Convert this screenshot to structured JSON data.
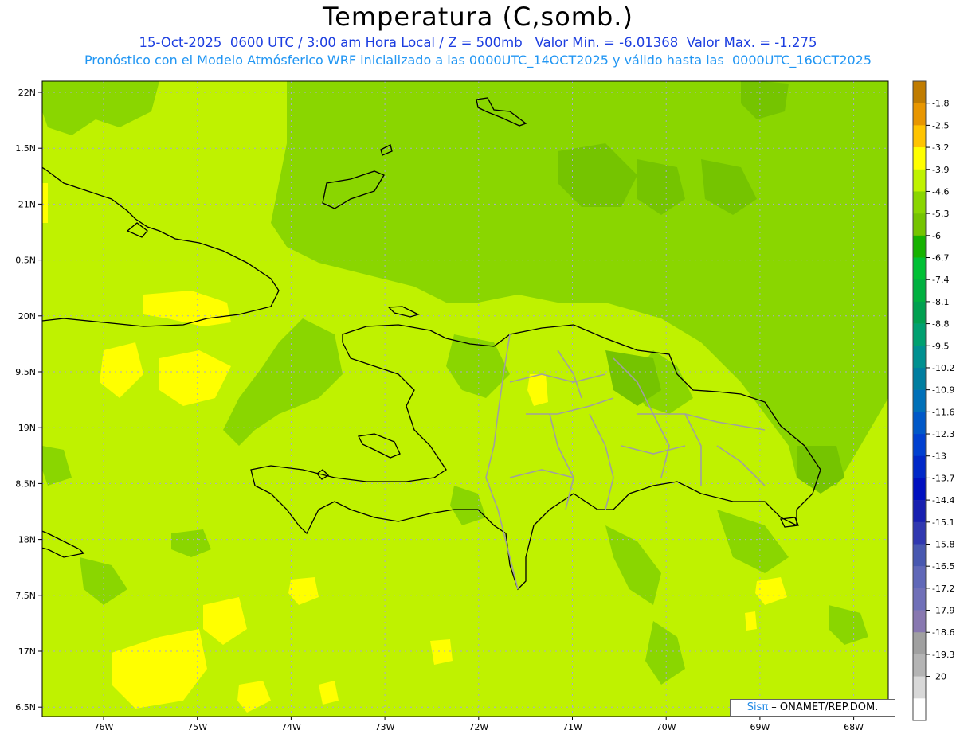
{
  "header": {
    "title": "Temperatura (C,somb.)",
    "subtitle1": "15-Oct-2025  0600 UTC / 3:00 am Hora Local / Z = 500mb   Valor Min. = -6.01368  Valor Max. = -1.275",
    "subtitle2": "Pronóstico con el Modelo Atmósferico WRF inicializado a las 0000UTC_14OCT2025 y válido hasta las  0000UTC_16OCT2025"
  },
  "map": {
    "lat_labels": [
      "22N",
      "1.5N",
      "21N",
      "0.5N",
      "20N",
      "9.5N",
      "19N",
      "8.5N",
      "18N",
      "7.5N",
      "17N",
      "6.5N"
    ],
    "lon_labels": [
      "76W",
      "75W",
      "74W",
      "73W",
      "72W",
      "71W",
      "70W",
      "69W",
      "68W"
    ],
    "field_colors": {
      "base": "#bff200",
      "darker": "#8ad600",
      "darkest": "#75c400",
      "warm": "#ffff00"
    },
    "coast_color": "#000000",
    "province_color": "#a0a0a0"
  },
  "colorbar": {
    "labels": [
      "-1.8",
      "-2.5",
      "-3.2",
      "-3.9",
      "-4.6",
      "-5.3",
      "-6",
      "-6.7",
      "-7.4",
      "-8.1",
      "-8.8",
      "-9.5",
      "-10.2",
      "-10.9",
      "-11.6",
      "-12.3",
      "-13",
      "-13.7",
      "-14.4",
      "-15.1",
      "-15.8",
      "-16.5",
      "-17.2",
      "-17.9",
      "-18.6",
      "-19.3",
      "-20"
    ],
    "colors": [
      "#c07c00",
      "#e89600",
      "#ffc400",
      "#ffff00",
      "#bff200",
      "#8ad600",
      "#75c400",
      "#16b200",
      "#00c034",
      "#00b040",
      "#00a050",
      "#00a070",
      "#009090",
      "#007ea0",
      "#0070b8",
      "#0058c8",
      "#0040d0",
      "#0028c8",
      "#0010c0",
      "#1820b0",
      "#3038b0",
      "#4858b0",
      "#6068b8",
      "#7070b8",
      "#8878b0",
      "#a0a0a0",
      "#b4b4b4",
      "#d8d8d8",
      "#ffffff"
    ]
  },
  "credit": {
    "brand": "Sisπ",
    "text": " – ONAMET/REP.DOM."
  }
}
